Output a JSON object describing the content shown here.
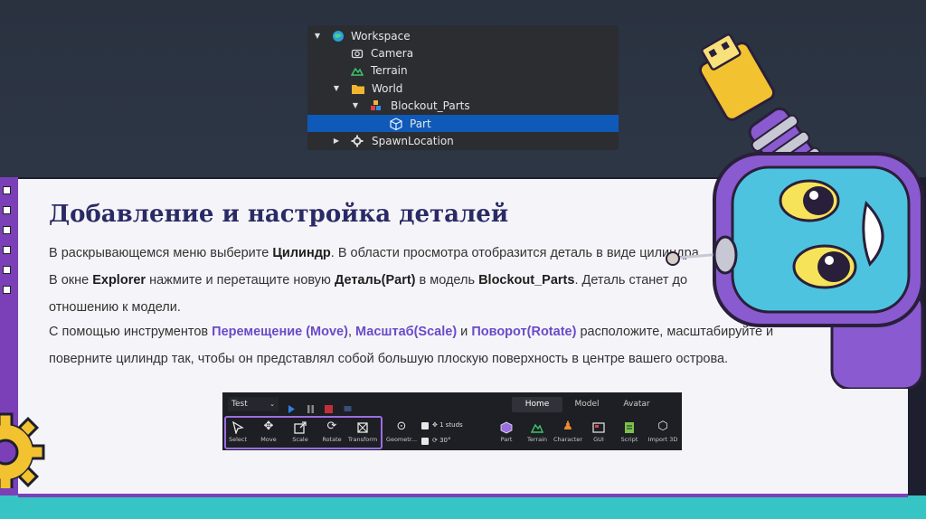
{
  "explorer": {
    "rows": [
      {
        "label": "Workspace",
        "icon": "globe-icon",
        "arrow": "expanded"
      },
      {
        "label": "Camera",
        "icon": "camera-icon",
        "arrow": ""
      },
      {
        "label": "Terrain",
        "icon": "terrain-icon",
        "arrow": ""
      },
      {
        "label": "World",
        "icon": "folder-icon",
        "arrow": "expanded"
      },
      {
        "label": "Blockout_Parts",
        "icon": "model-icon",
        "arrow": "expanded"
      },
      {
        "label": "Part",
        "icon": "part-icon",
        "arrow": "",
        "selected": true
      },
      {
        "label": "SpawnLocation",
        "icon": "spawn-icon",
        "arrow": "collapsed"
      }
    ]
  },
  "slide": {
    "title": "Добавление и настройка деталей",
    "line1": {
      "a": "В раскрывающемся меню выберите ",
      "b": "Цилиндр",
      "c": ". В области просмотра отобразится деталь в виде цилиндра."
    },
    "line2": {
      "a": "В окне ",
      "b": "Explorer",
      "c": " нажмите и перетащите новую ",
      "d": "Деталь(Part)",
      "e": " в модель ",
      "f": "Blockout_Parts",
      "g": ". Деталь станет до"
    },
    "line3": "отношению к модели.",
    "line4": {
      "a": "С помощью инструментов ",
      "b": "Перемещение (Move)",
      "c": ", ",
      "d": "Масштаб(Scale)",
      "e": " и ",
      "f": "Поворот(Rotate)",
      "g": " расположите, масштабируйте и"
    },
    "line5": "поверните цилиндр так, чтобы он представлял собой большую плоскую поверхность в центре вашего острова."
  },
  "toolbar": {
    "mode_select": "Test",
    "tabs": [
      "Home",
      "Model",
      "Avatar"
    ],
    "active_tab": "Home",
    "tools": [
      "Select",
      "Move",
      "Scale",
      "Rotate",
      "Transform"
    ],
    "geometry_label": "Geometr...",
    "move_snap": "1 studs",
    "rotate_snap": "30°",
    "insert": [
      "Part",
      "Terrain",
      "Character",
      "GUI",
      "Script",
      "Import 3D"
    ]
  },
  "colors": {
    "accent": "#6a4ac8",
    "title": "#2a2a66",
    "selection": "#0f5ab8",
    "frame": "#7b3fb8",
    "teal": "#36c4c4"
  }
}
